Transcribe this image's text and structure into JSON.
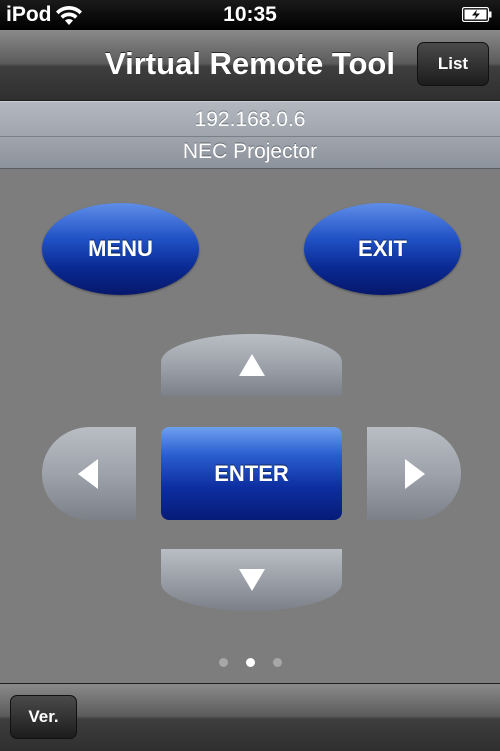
{
  "status_bar": {
    "carrier": "iPod",
    "time": "10:35",
    "wifi_icon": "wifi-icon",
    "battery_icon": "battery-charging-icon"
  },
  "nav_bar": {
    "title": "Virtual Remote Tool",
    "list_button": "List"
  },
  "device": {
    "ip": "192.168.0.6",
    "name": "NEC Projector"
  },
  "remote": {
    "menu_label": "MENU",
    "exit_label": "EXIT",
    "enter_label": "ENTER",
    "up_icon": "arrow-up-icon",
    "down_icon": "arrow-down-icon",
    "left_icon": "arrow-left-icon",
    "right_icon": "arrow-right-icon"
  },
  "page_control": {
    "count": 3,
    "current": 2
  },
  "toolbar": {
    "ver_button": "Ver."
  },
  "colors": {
    "background": "#7d7d7d",
    "button_blue": "#0a2a93",
    "direction_gray": "#9ea3ab"
  }
}
